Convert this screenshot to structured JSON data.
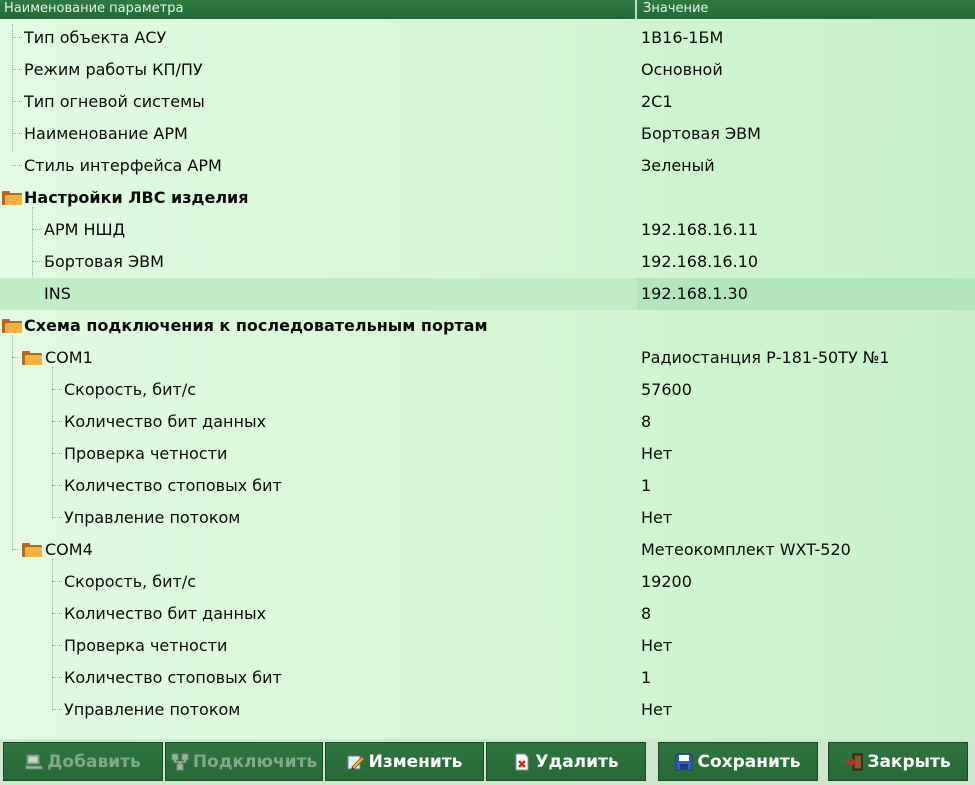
{
  "header": {
    "col_name": "Наименование параметра",
    "col_value": "Значение"
  },
  "rows": [
    {
      "name": "Тип объекта АСУ",
      "value": "1В16-1БМ"
    },
    {
      "name": "Режим работы КП/ПУ",
      "value": "Основной"
    },
    {
      "name": "Тип огневой системы",
      "value": "2С1"
    },
    {
      "name": "Наименование АРМ",
      "value": "Бортовая ЭВМ"
    },
    {
      "name": "Стиль интерфейса АРМ",
      "value": "Зеленый"
    },
    {
      "name": "Настройки ЛВС изделия",
      "value": ""
    },
    {
      "name": "АРМ НШД",
      "value": "192.168.16.11"
    },
    {
      "name": "Бортовая ЭВМ",
      "value": "192.168.16.10"
    },
    {
      "name": "INS",
      "value": "192.168.1.30"
    },
    {
      "name": "Схема подключения к последовательным портам",
      "value": ""
    },
    {
      "name": "COM1",
      "value": "Радиостанция Р-181-50ТУ №1"
    },
    {
      "name": "Скорость, бит/с",
      "value": "57600"
    },
    {
      "name": "Количество бит данных",
      "value": "8"
    },
    {
      "name": "Проверка четности",
      "value": "Нет"
    },
    {
      "name": "Количество стоповых бит",
      "value": "1"
    },
    {
      "name": "Управление потоком",
      "value": "Нет"
    },
    {
      "name": "COM4",
      "value": "Метеокомплект WXT-520"
    },
    {
      "name": "Скорость, бит/с",
      "value": "19200"
    },
    {
      "name": "Количество бит данных",
      "value": "8"
    },
    {
      "name": "Проверка четности",
      "value": "Нет"
    },
    {
      "name": "Количество стоповых бит",
      "value": "1"
    },
    {
      "name": "Управление потоком",
      "value": "Нет"
    }
  ],
  "buttons": {
    "add": "Добавить",
    "connect": "Подключить",
    "edit": "Изменить",
    "delete": "Удалить",
    "save": "Сохранить",
    "close": "Закрыть"
  },
  "icons": {
    "folder": "folder-icon",
    "add": "computer-icon",
    "connect": "network-icon",
    "edit": "pencil-icon",
    "delete": "delete-doc-icon",
    "save": "floppy-icon",
    "close": "exit-door-icon"
  },
  "colors": {
    "header": "#2a7040",
    "background": "#d7f7d7",
    "selected": "#c0ecc6",
    "button": "#2b6f3b"
  }
}
